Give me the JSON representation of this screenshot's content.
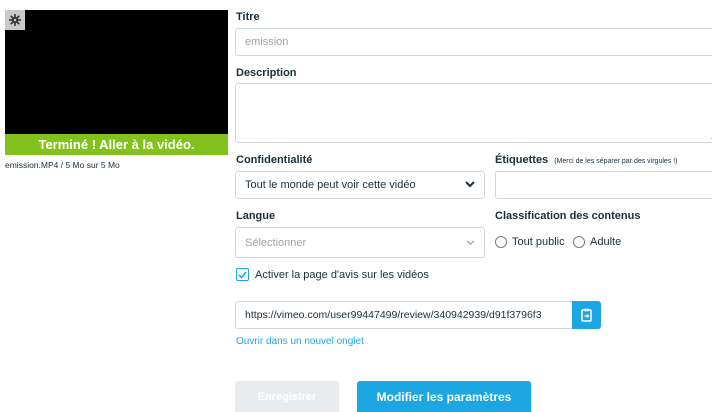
{
  "preview": {
    "done_text": "Terminé ! Aller à la vidéo.",
    "file_info": "emission.MP4 / 5 Mo sur 5 Mo"
  },
  "form": {
    "title_label": "Titre",
    "title_value": "emission",
    "description_label": "Description",
    "description_value": "",
    "privacy_label": "Confidentialité",
    "privacy_value": "Tout le monde peut voir cette vidéo",
    "tags_label": "Étiquettes",
    "tags_hint": "(Merci de les séparer par des virgules !)",
    "language_label": "Langue",
    "language_placeholder": "Sélectionner",
    "content_rating_label": "Classification des contenus",
    "rating_options": [
      "Tout public",
      "Adulte"
    ],
    "review_page_label": "Activer la page d'avis sur les vidéos",
    "review_page_checked": true,
    "review_url": "https://vimeo.com/user99447499/review/340942939/d91f3796f3",
    "open_new_tab": "Ouvrir dans un nouvel onglet",
    "save_button": "Enregistrer",
    "modify_button": "Modifier les paramètres"
  },
  "colors": {
    "accent": "#1ca7e3",
    "success": "#83c21d"
  },
  "icons": {
    "gear": "gear-icon",
    "chevron": "chevron-down-icon",
    "copy": "copy-icon",
    "check": "checkmark-icon"
  }
}
